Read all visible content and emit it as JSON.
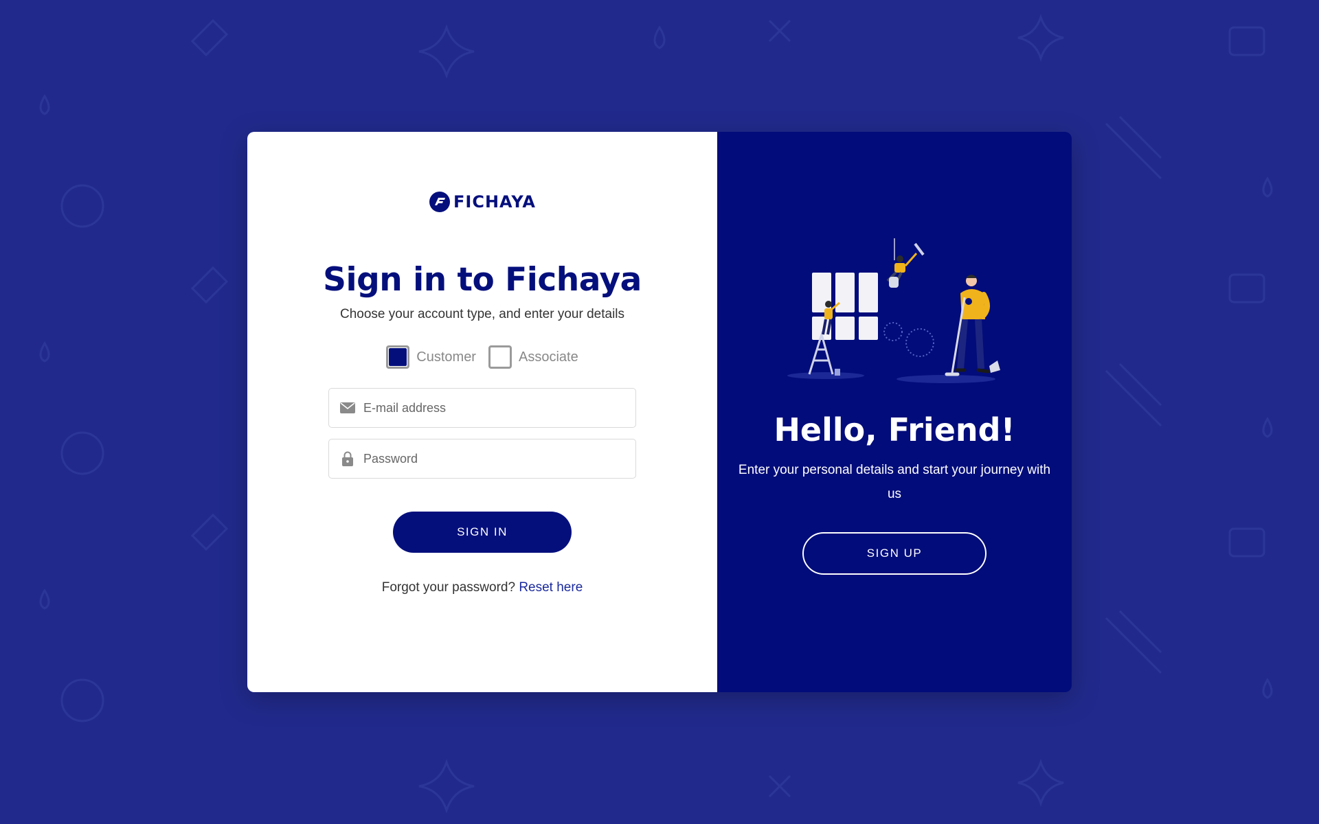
{
  "brand": {
    "name": "FICHAYA"
  },
  "signin": {
    "title": "Sign in to Fichaya",
    "subtitle": "Choose your account type, and enter your details",
    "account_types": [
      {
        "label": "Customer",
        "selected": true
      },
      {
        "label": "Associate",
        "selected": false
      }
    ],
    "email": {
      "placeholder": "E-mail address",
      "value": "",
      "icon": "mail-icon"
    },
    "password": {
      "placeholder": "Password",
      "value": "",
      "icon": "lock-icon"
    },
    "submit_label": "SIGN IN",
    "forgot_text": "Forgot your password?",
    "reset_link": "Reset here"
  },
  "signup": {
    "heading": "Hello, Friend!",
    "text": "Enter your personal details and start your journey with us",
    "button_label": "SIGN UP"
  },
  "colors": {
    "page_background": "#212a8c",
    "brand_navy": "#050f7c",
    "panel_navy": "#020c7a",
    "accent_yellow": "#f0b31c"
  }
}
